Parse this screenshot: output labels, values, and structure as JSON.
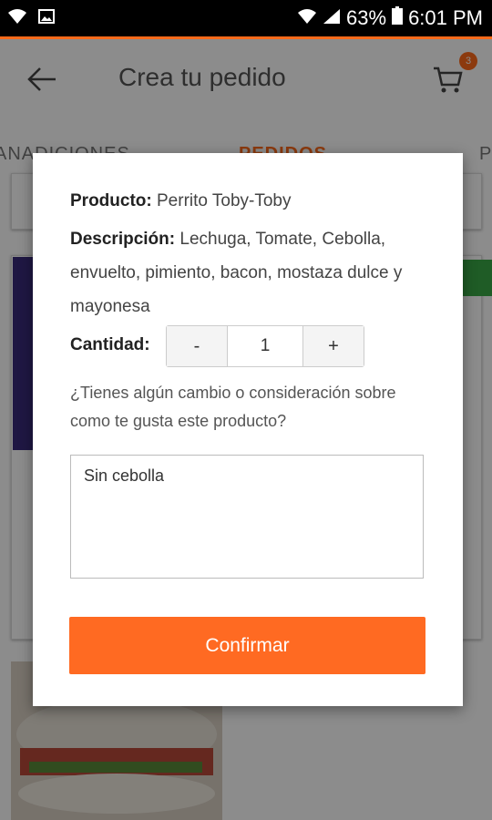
{
  "status_bar": {
    "battery_percent": "63%",
    "time": "6:01 PM",
    "icons": [
      "wifi-icon",
      "image-icon",
      "wifi-icon",
      "signal-icon",
      "battery-icon"
    ]
  },
  "app_bar": {
    "title": "Crea tu pedido",
    "cart_count": "3",
    "accent_color": "#ff6a1a"
  },
  "tabs": [
    {
      "label": "ANADICIONES"
    },
    {
      "label": "PEDIDOS"
    },
    {
      "label": "P"
    }
  ],
  "dialog": {
    "product_label": "Producto:",
    "product_value": "Perrito Toby-Toby",
    "description_label": "Descripción:",
    "description_value": "Lechuga, Tomate, Cebolla, envuelto, pimiento, bacon, mostaza dulce y mayonesa",
    "quantity_label": "Cantidad:",
    "minus_label": "-",
    "quantity_value": "1",
    "plus_label": "+",
    "question": "¿Tienes algún cambio o consideración sobre como te gusta este producto?",
    "notes_value": "Sin cebolla",
    "confirm_label": "Confirmar",
    "confirm_color": "#ff6a22"
  }
}
